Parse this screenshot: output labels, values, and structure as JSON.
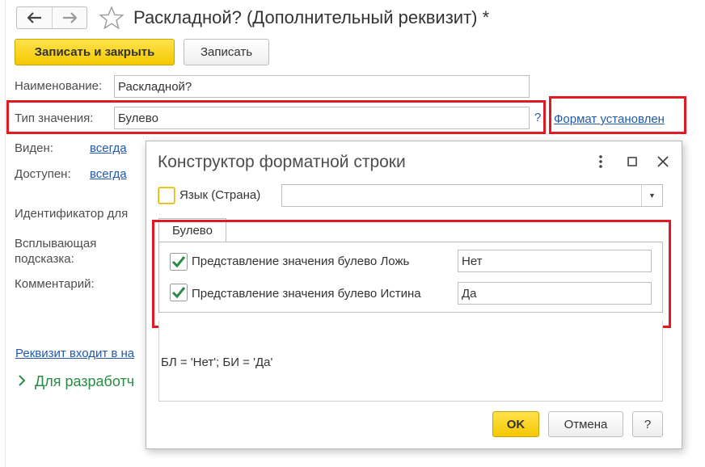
{
  "window": {
    "title": "Раскладной? (Дополнительный реквизит) *",
    "nav": {
      "back_icon": "arrow-left-icon",
      "forward_icon": "arrow-right-icon"
    },
    "favorite_icon": "star-icon"
  },
  "toolbar": {
    "save_close_label": "Записать и закрыть",
    "save_label": "Записать"
  },
  "form": {
    "name_label": "Наименование:",
    "name_value": "Раскладной?",
    "type_label": "Тип значения:",
    "type_value": "Булево",
    "type_help": "?",
    "format_link": "Формат установлен",
    "visible_label": "Виден:",
    "visible_value": "всегда",
    "available_label": "Доступен:",
    "available_value": "всегда",
    "identifier_label": "Идентификатор для",
    "tooltip_label_line1": "Всплывающая",
    "tooltip_label_line2": "подсказка:",
    "comment_label": "Комментарий:",
    "set_link": "Реквизит входит в на",
    "dev_section": "Для разработч",
    "dev_section_icon": "chevron-right-icon"
  },
  "dialog": {
    "title": "Конструктор форматной строки",
    "icons": {
      "menu": "more-vertical-icon",
      "maximize": "maximize-icon",
      "close": "close-icon"
    },
    "language_label": "Язык (Страна)",
    "language_value": "",
    "tab_label": "Булево",
    "false_label": "Представление значения булево Ложь",
    "false_value": "Нет",
    "false_checked": true,
    "true_label": "Представление значения булево Истина",
    "true_value": "Да",
    "true_checked": true,
    "format_string": "БЛ = 'Нет'; БИ = 'Да'",
    "ok_label": "OK",
    "cancel_label": "Отмена",
    "help_label": "?"
  },
  "colors": {
    "highlight": "#e01a22",
    "primary_button": "#f5c800",
    "link": "#2259a8",
    "check": "#2a8a46"
  }
}
